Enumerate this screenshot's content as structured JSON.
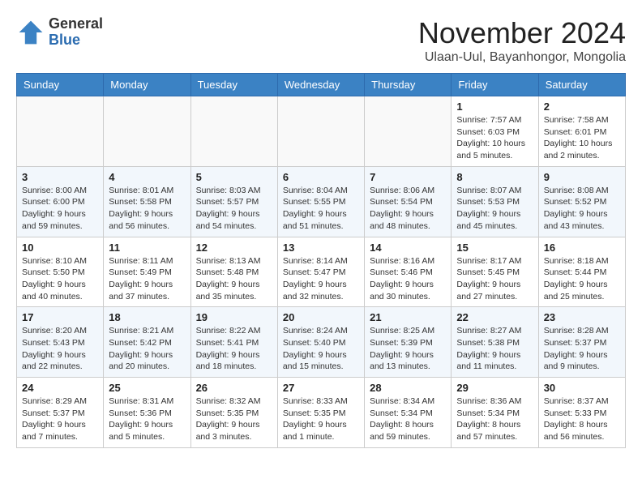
{
  "header": {
    "logo_general": "General",
    "logo_blue": "Blue",
    "month_title": "November 2024",
    "location": "Ulaan-Uul, Bayanhongor, Mongolia"
  },
  "days_of_week": [
    "Sunday",
    "Monday",
    "Tuesday",
    "Wednesday",
    "Thursday",
    "Friday",
    "Saturday"
  ],
  "weeks": [
    {
      "cells": [
        {
          "day": null,
          "info": null
        },
        {
          "day": null,
          "info": null
        },
        {
          "day": null,
          "info": null
        },
        {
          "day": null,
          "info": null
        },
        {
          "day": null,
          "info": null
        },
        {
          "day": "1",
          "info": "Sunrise: 7:57 AM\nSunset: 6:03 PM\nDaylight: 10 hours and 5 minutes."
        },
        {
          "day": "2",
          "info": "Sunrise: 7:58 AM\nSunset: 6:01 PM\nDaylight: 10 hours and 2 minutes."
        }
      ]
    },
    {
      "cells": [
        {
          "day": "3",
          "info": "Sunrise: 8:00 AM\nSunset: 6:00 PM\nDaylight: 9 hours and 59 minutes."
        },
        {
          "day": "4",
          "info": "Sunrise: 8:01 AM\nSunset: 5:58 PM\nDaylight: 9 hours and 56 minutes."
        },
        {
          "day": "5",
          "info": "Sunrise: 8:03 AM\nSunset: 5:57 PM\nDaylight: 9 hours and 54 minutes."
        },
        {
          "day": "6",
          "info": "Sunrise: 8:04 AM\nSunset: 5:55 PM\nDaylight: 9 hours and 51 minutes."
        },
        {
          "day": "7",
          "info": "Sunrise: 8:06 AM\nSunset: 5:54 PM\nDaylight: 9 hours and 48 minutes."
        },
        {
          "day": "8",
          "info": "Sunrise: 8:07 AM\nSunset: 5:53 PM\nDaylight: 9 hours and 45 minutes."
        },
        {
          "day": "9",
          "info": "Sunrise: 8:08 AM\nSunset: 5:52 PM\nDaylight: 9 hours and 43 minutes."
        }
      ]
    },
    {
      "cells": [
        {
          "day": "10",
          "info": "Sunrise: 8:10 AM\nSunset: 5:50 PM\nDaylight: 9 hours and 40 minutes."
        },
        {
          "day": "11",
          "info": "Sunrise: 8:11 AM\nSunset: 5:49 PM\nDaylight: 9 hours and 37 minutes."
        },
        {
          "day": "12",
          "info": "Sunrise: 8:13 AM\nSunset: 5:48 PM\nDaylight: 9 hours and 35 minutes."
        },
        {
          "day": "13",
          "info": "Sunrise: 8:14 AM\nSunset: 5:47 PM\nDaylight: 9 hours and 32 minutes."
        },
        {
          "day": "14",
          "info": "Sunrise: 8:16 AM\nSunset: 5:46 PM\nDaylight: 9 hours and 30 minutes."
        },
        {
          "day": "15",
          "info": "Sunrise: 8:17 AM\nSunset: 5:45 PM\nDaylight: 9 hours and 27 minutes."
        },
        {
          "day": "16",
          "info": "Sunrise: 8:18 AM\nSunset: 5:44 PM\nDaylight: 9 hours and 25 minutes."
        }
      ]
    },
    {
      "cells": [
        {
          "day": "17",
          "info": "Sunrise: 8:20 AM\nSunset: 5:43 PM\nDaylight: 9 hours and 22 minutes."
        },
        {
          "day": "18",
          "info": "Sunrise: 8:21 AM\nSunset: 5:42 PM\nDaylight: 9 hours and 20 minutes."
        },
        {
          "day": "19",
          "info": "Sunrise: 8:22 AM\nSunset: 5:41 PM\nDaylight: 9 hours and 18 minutes."
        },
        {
          "day": "20",
          "info": "Sunrise: 8:24 AM\nSunset: 5:40 PM\nDaylight: 9 hours and 15 minutes."
        },
        {
          "day": "21",
          "info": "Sunrise: 8:25 AM\nSunset: 5:39 PM\nDaylight: 9 hours and 13 minutes."
        },
        {
          "day": "22",
          "info": "Sunrise: 8:27 AM\nSunset: 5:38 PM\nDaylight: 9 hours and 11 minutes."
        },
        {
          "day": "23",
          "info": "Sunrise: 8:28 AM\nSunset: 5:37 PM\nDaylight: 9 hours and 9 minutes."
        }
      ]
    },
    {
      "cells": [
        {
          "day": "24",
          "info": "Sunrise: 8:29 AM\nSunset: 5:37 PM\nDaylight: 9 hours and 7 minutes."
        },
        {
          "day": "25",
          "info": "Sunrise: 8:31 AM\nSunset: 5:36 PM\nDaylight: 9 hours and 5 minutes."
        },
        {
          "day": "26",
          "info": "Sunrise: 8:32 AM\nSunset: 5:35 PM\nDaylight: 9 hours and 3 minutes."
        },
        {
          "day": "27",
          "info": "Sunrise: 8:33 AM\nSunset: 5:35 PM\nDaylight: 9 hours and 1 minute."
        },
        {
          "day": "28",
          "info": "Sunrise: 8:34 AM\nSunset: 5:34 PM\nDaylight: 8 hours and 59 minutes."
        },
        {
          "day": "29",
          "info": "Sunrise: 8:36 AM\nSunset: 5:34 PM\nDaylight: 8 hours and 57 minutes."
        },
        {
          "day": "30",
          "info": "Sunrise: 8:37 AM\nSunset: 5:33 PM\nDaylight: 8 hours and 56 minutes."
        }
      ]
    }
  ]
}
